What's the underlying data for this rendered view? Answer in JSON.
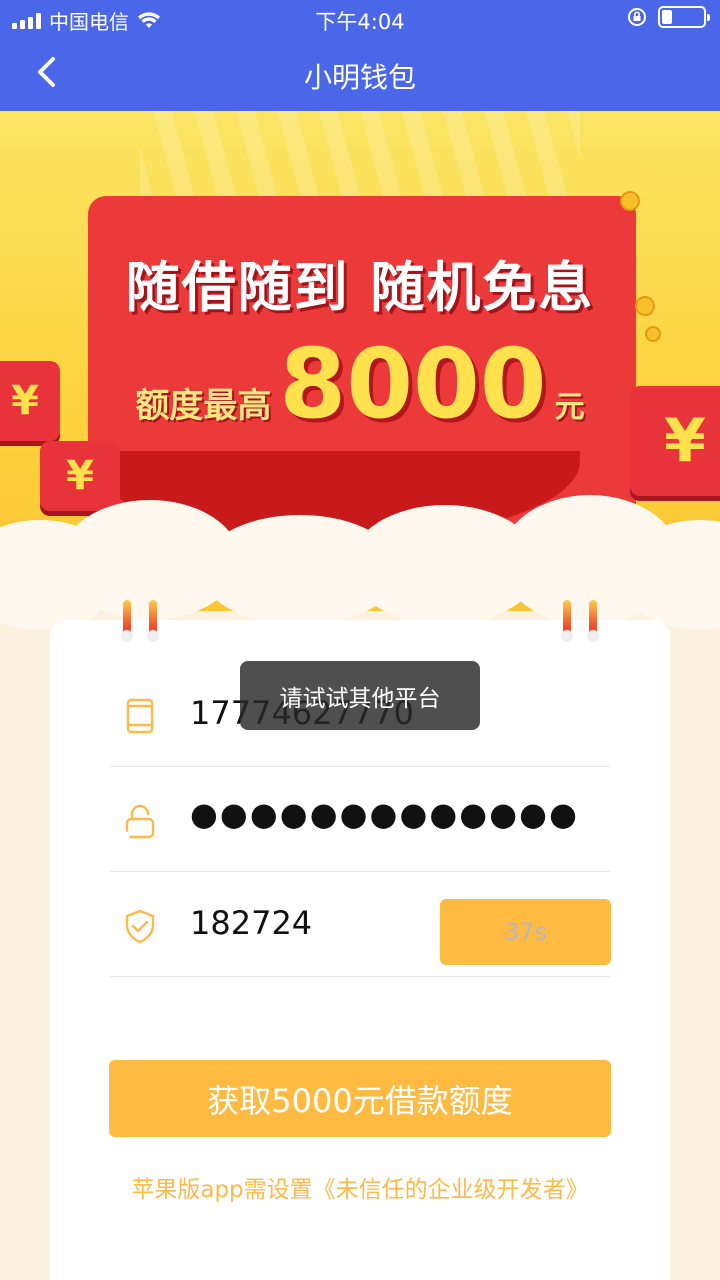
{
  "status_bar": {
    "carrier": "中国电信",
    "time": "下午4:04"
  },
  "nav": {
    "title": "小明钱包"
  },
  "banner": {
    "headline": "随借随到 随机免息",
    "amount_label": "额度最高",
    "amount": "8000",
    "amount_unit": "元",
    "currency_symbol": "¥"
  },
  "form": {
    "phone": "17774627770",
    "password_masked": "●●●●●●●●●●●●●",
    "code": "182724",
    "countdown": "37s"
  },
  "submit_label": "获取5000元借款额度",
  "hint": "苹果版app需设置《未信任的企业级开发者》",
  "toast": "请试试其他平台",
  "colors": {
    "primary": "#4a67ea",
    "accent": "#ffba42",
    "hint": "#ffb94a"
  }
}
